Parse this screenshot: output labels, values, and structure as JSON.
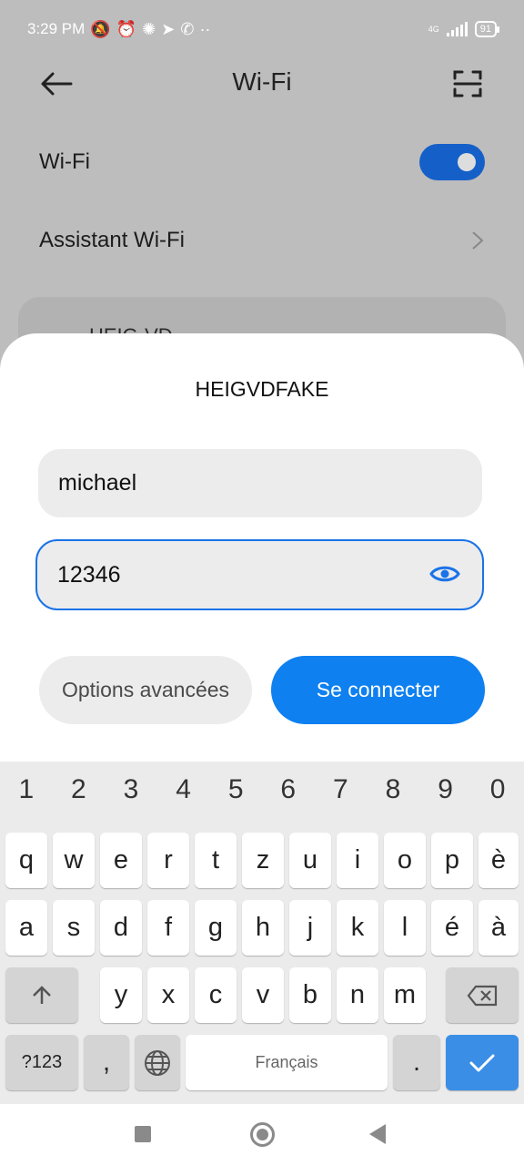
{
  "status_bar": {
    "time": "3:29 PM",
    "network": "4G",
    "battery": "91"
  },
  "header": {
    "title": "Wi-Fi"
  },
  "settings": {
    "wifi_label": "Wi-Fi",
    "wifi_enabled": true,
    "assistant_label": "Assistant Wi-Fi",
    "network_partial": "HEIG-VD"
  },
  "dialog": {
    "title": "HEIGVDFAKE",
    "identity_value": "michael",
    "password_value": "12346",
    "advanced_label": "Options avancées",
    "connect_label": "Se connecter"
  },
  "keyboard": {
    "numbers": [
      "1",
      "2",
      "3",
      "4",
      "5",
      "6",
      "7",
      "8",
      "9",
      "0"
    ],
    "row1": [
      "q",
      "w",
      "e",
      "r",
      "t",
      "z",
      "u",
      "i",
      "o",
      "p",
      "è"
    ],
    "row2": [
      "a",
      "s",
      "d",
      "f",
      "g",
      "h",
      "j",
      "k",
      "l",
      "é",
      "à"
    ],
    "row3": [
      "y",
      "x",
      "c",
      "v",
      "b",
      "n",
      "m"
    ],
    "symbols_label": "?123",
    "comma": ",",
    "space_label": "Français",
    "period": "."
  },
  "colors": {
    "accent": "#0e80f0",
    "toggle_on": "#1560c8",
    "field_bg": "#ececec"
  }
}
